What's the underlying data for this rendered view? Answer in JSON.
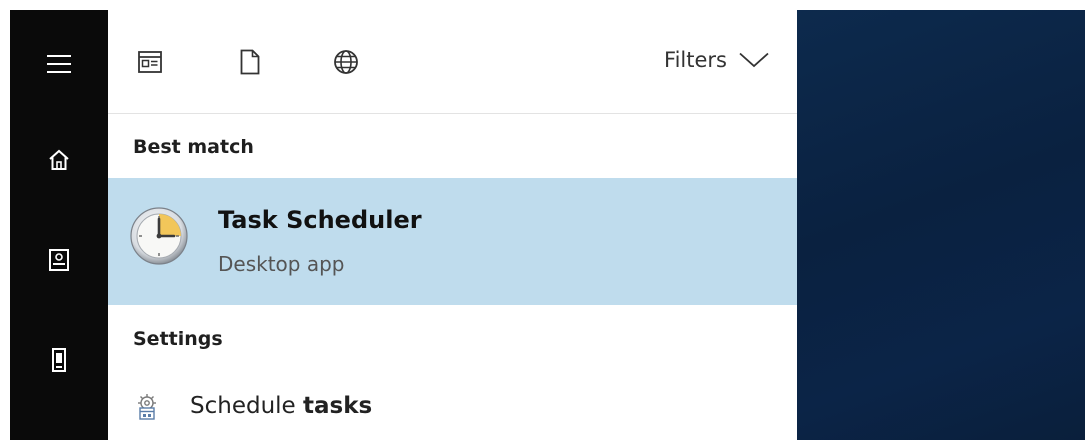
{
  "toolbar": {
    "icons": [
      "apps-icon",
      "document-icon",
      "web-icon"
    ],
    "filters_label": "Filters"
  },
  "sections": {
    "best_match_heading": "Best match",
    "settings_heading": "Settings"
  },
  "best_match": {
    "title": "Task Scheduler",
    "subtitle": "Desktop app",
    "icon": "clock-icon"
  },
  "settings_items": [
    {
      "label_plain": "Schedule ",
      "label_bold": "tasks",
      "icon": "schedule-settings-icon"
    }
  ],
  "rail": {
    "icons": [
      "hamburger-menu-icon",
      "home-icon",
      "notebook-icon",
      "device-icon"
    ]
  },
  "colors": {
    "rail": "#0a0a0a",
    "highlight": "#bfdced",
    "desktop": "#0b2447"
  }
}
